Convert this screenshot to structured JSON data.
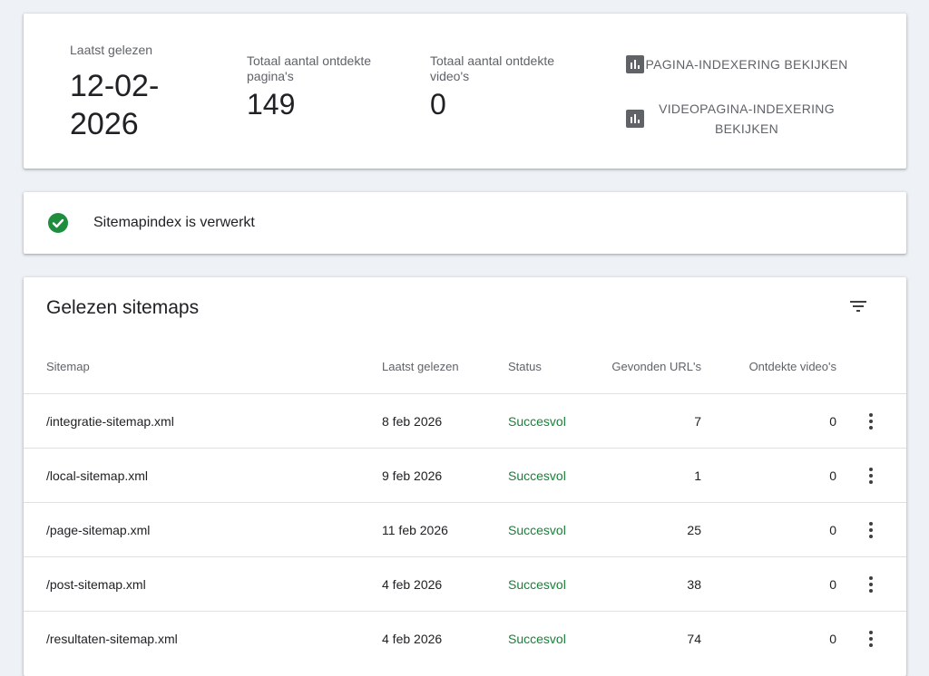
{
  "summary": {
    "last_read_label": "Laatst gelezen",
    "last_read_value": "12-02-2026",
    "pages_label": "Totaal aantal ontdekte pagina's",
    "pages_value": "149",
    "videos_label": "Totaal aantal ontdekte video's",
    "videos_value": "0",
    "page_indexing_button": "PAGINA-INDEXERING BEKIJKEN",
    "video_indexing_button": "VIDEOPAGINA-INDEXERING BEKIJKEN"
  },
  "status": {
    "message": "Sitemapindex is verwerkt",
    "color": "#1e8e3e"
  },
  "table": {
    "title": "Gelezen sitemaps",
    "columns": {
      "sitemap": "Sitemap",
      "last_read": "Laatst gelezen",
      "status": "Status",
      "urls": "Gevonden URL's",
      "videos": "Ontdekte video's"
    },
    "rows": [
      {
        "sitemap": "/integratie-sitemap.xml",
        "last_read": "8 feb 2026",
        "status": "Succesvol",
        "urls": "7",
        "videos": "0"
      },
      {
        "sitemap": "/local-sitemap.xml",
        "last_read": "9 feb 2026",
        "status": "Succesvol",
        "urls": "1",
        "videos": "0"
      },
      {
        "sitemap": "/page-sitemap.xml",
        "last_read": "11 feb 2026",
        "status": "Succesvol",
        "urls": "25",
        "videos": "0"
      },
      {
        "sitemap": "/post-sitemap.xml",
        "last_read": "4 feb 2026",
        "status": "Succesvol",
        "urls": "38",
        "videos": "0"
      },
      {
        "sitemap": "/resultaten-sitemap.xml",
        "last_read": "4 feb 2026",
        "status": "Succesvol",
        "urls": "74",
        "videos": "0"
      }
    ]
  },
  "icons": {
    "chart": "bar-chart-icon",
    "check": "check-circle-icon",
    "filter": "filter-icon",
    "more": "more-vert-icon"
  },
  "colors": {
    "background": "#eef1f5",
    "success": "#188038",
    "muted": "#5f6368"
  }
}
